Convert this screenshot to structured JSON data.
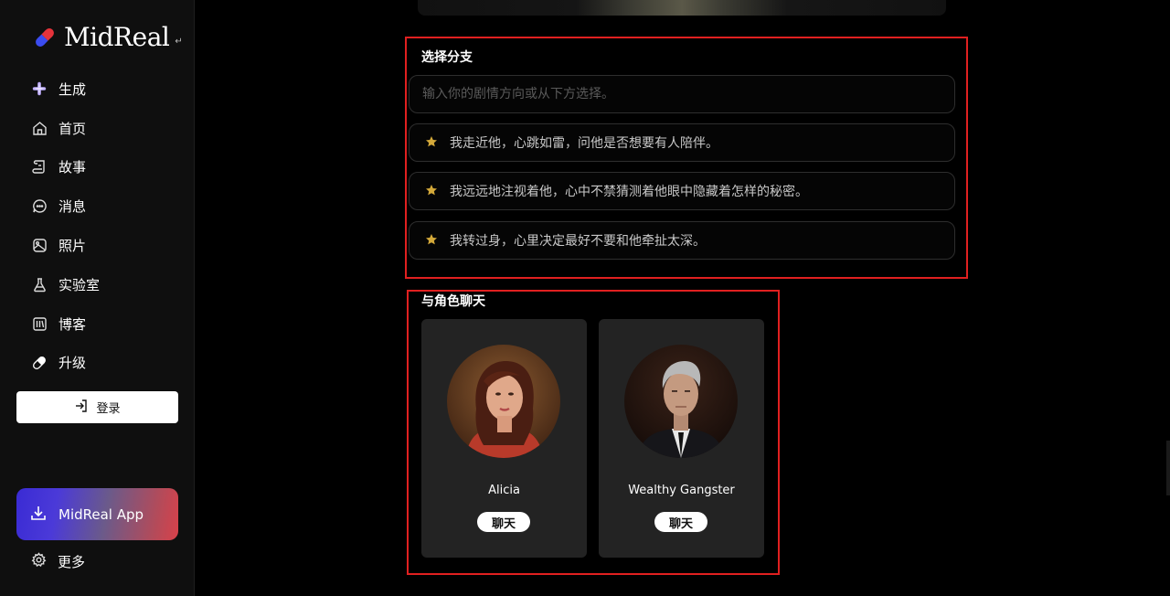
{
  "app": {
    "name": "MidReal",
    "logo_suffix": "↵"
  },
  "sidebar": {
    "items": [
      {
        "label": "生成",
        "icon": "plus-icon"
      },
      {
        "label": "首页",
        "icon": "home-icon"
      },
      {
        "label": "故事",
        "icon": "scroll-icon"
      },
      {
        "label": "消息",
        "icon": "chat-bubble-icon"
      },
      {
        "label": "照片",
        "icon": "photo-icon"
      },
      {
        "label": "实验室",
        "icon": "flask-icon"
      },
      {
        "label": "博客",
        "icon": "library-icon"
      },
      {
        "label": "升级",
        "icon": "pill-icon"
      }
    ],
    "login_label": "登录",
    "app_button_label": "MidReal App",
    "more_label": "更多"
  },
  "branch": {
    "title": "选择分支",
    "input_placeholder": "输入你的剧情方向或从下方选择。",
    "options": [
      "我走近他，心跳如雷，问他是否想要有人陪伴。",
      "我远远地注视着他，心中不禁猜测着他眼中隐藏着怎样的秘密。",
      "我转过身，心里决定最好不要和他牵扯太深。"
    ]
  },
  "characters": {
    "title": "与角色聊天",
    "list": [
      {
        "name": "Alicia",
        "button": "聊天"
      },
      {
        "name": "Wealthy Gangster",
        "button": "聊天"
      }
    ]
  },
  "colors": {
    "highlight": "#e02020",
    "star": "#d4a93a",
    "card_bg": "#232323"
  }
}
